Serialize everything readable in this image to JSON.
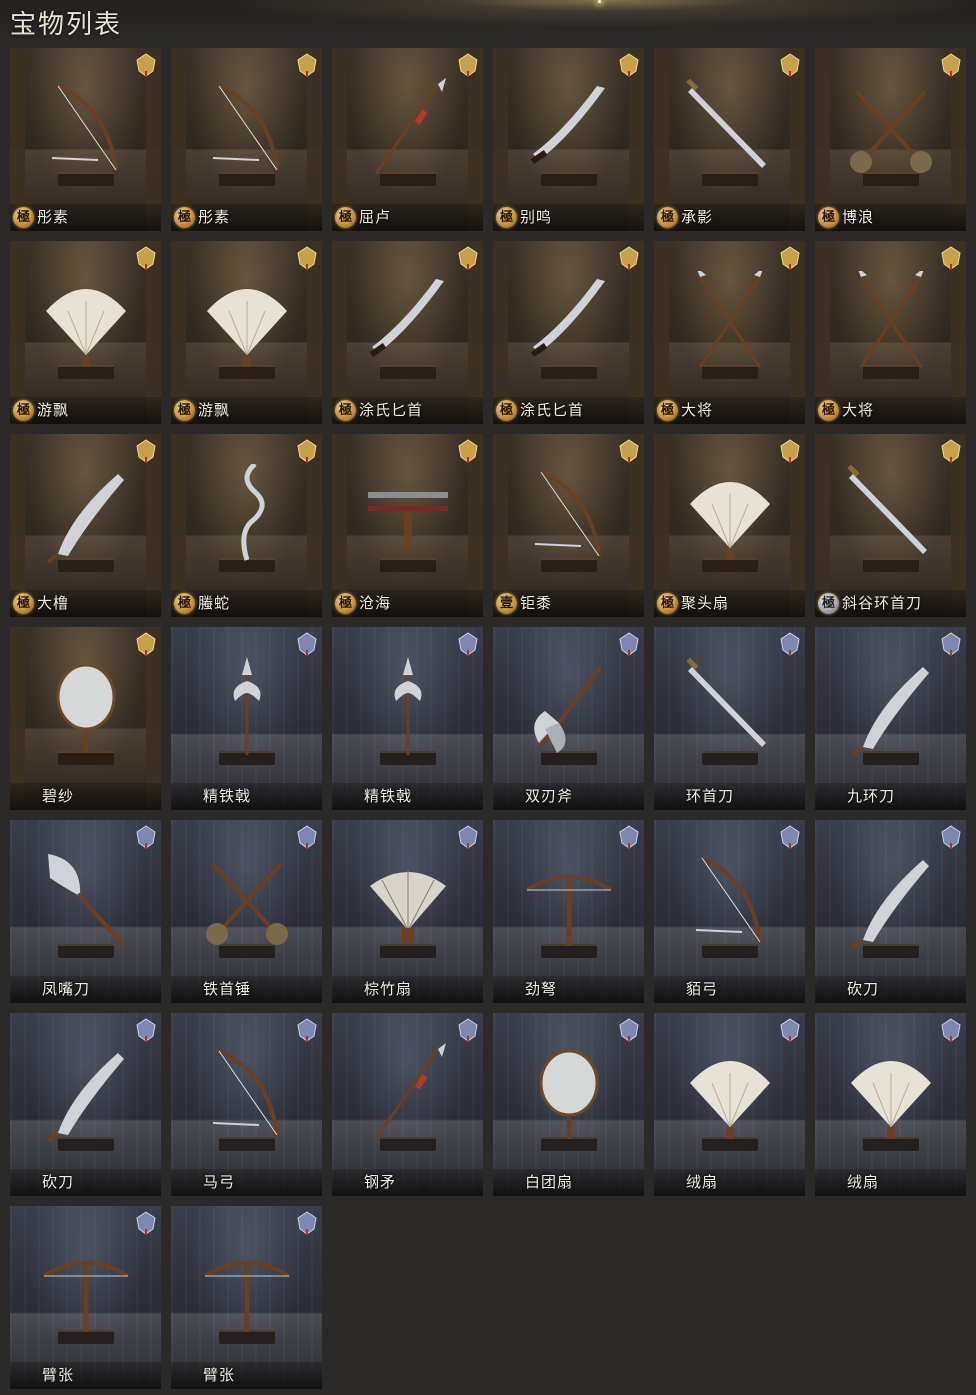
{
  "page": {
    "title": "宝物列表"
  },
  "colors": {
    "gold_rank": "#c8923e",
    "silver_rank": "#a8a8ae",
    "gold_bg": "#3a3127",
    "blue_bg": "#3a3e4a"
  },
  "cards": [
    {
      "name": "彤素",
      "rank": "極",
      "tier": "gold",
      "icon": "bow-icon"
    },
    {
      "name": "彤素",
      "rank": "極",
      "tier": "gold",
      "icon": "bow-icon"
    },
    {
      "name": "屈卢",
      "rank": "極",
      "tier": "gold",
      "icon": "spear-icon"
    },
    {
      "name": "别鸣",
      "rank": "極",
      "tier": "gold",
      "icon": "dagger-icon"
    },
    {
      "name": "承影",
      "rank": "極",
      "tier": "gold",
      "icon": "sword-icon"
    },
    {
      "name": "博浪",
      "rank": "極",
      "tier": "gold",
      "icon": "hammer-icon"
    },
    {
      "name": "游飘",
      "rank": "極",
      "tier": "gold",
      "icon": "feather-fan-icon"
    },
    {
      "name": "游飘",
      "rank": "極",
      "tier": "gold",
      "icon": "feather-fan-icon"
    },
    {
      "name": "涂氏匕首",
      "rank": "極",
      "tier": "gold",
      "icon": "dagger-icon"
    },
    {
      "name": "涂氏匕首",
      "rank": "極",
      "tier": "gold",
      "icon": "dagger-icon"
    },
    {
      "name": "大将",
      "rank": "極",
      "tier": "gold",
      "icon": "crossed-spears-icon"
    },
    {
      "name": "大将",
      "rank": "極",
      "tier": "gold",
      "icon": "crossed-spears-icon"
    },
    {
      "name": "大橹",
      "rank": "極",
      "tier": "gold",
      "icon": "blade-icon"
    },
    {
      "name": "螣蛇",
      "rank": "極",
      "tier": "gold",
      "icon": "serpent-spear-icon"
    },
    {
      "name": "沧海",
      "rank": "極",
      "tier": "gold",
      "icon": "sword-rack-icon"
    },
    {
      "name": "钜黍",
      "rank": "壹",
      "tier": "gold",
      "icon": "bow-icon"
    },
    {
      "name": "聚头扇",
      "rank": "極",
      "tier": "gold",
      "icon": "feather-fan-icon"
    },
    {
      "name": "斜谷环首刀",
      "rank": "極",
      "tier": "gold",
      "rank_style": "silver",
      "icon": "sword-icon"
    },
    {
      "name": "碧纱",
      "rank": "",
      "tier": "gold",
      "icon": "round-fan-icon"
    },
    {
      "name": "精铁戟",
      "rank": "",
      "tier": "blue",
      "icon": "halberd-icon"
    },
    {
      "name": "精铁戟",
      "rank": "",
      "tier": "blue",
      "icon": "halberd-icon"
    },
    {
      "name": "双刃斧",
      "rank": "",
      "tier": "blue",
      "icon": "axe-icon"
    },
    {
      "name": "环首刀",
      "rank": "",
      "tier": "blue",
      "icon": "sword-icon"
    },
    {
      "name": "九环刀",
      "rank": "",
      "tier": "blue",
      "icon": "blade-icon"
    },
    {
      "name": "凤嘴刀",
      "rank": "",
      "tier": "blue",
      "icon": "glaive-icon"
    },
    {
      "name": "铁首锤",
      "rank": "",
      "tier": "blue",
      "icon": "hammer-icon"
    },
    {
      "name": "棕竹扇",
      "rank": "",
      "tier": "blue",
      "icon": "folding-fan-icon"
    },
    {
      "name": "劲弩",
      "rank": "",
      "tier": "blue",
      "icon": "crossbow-icon"
    },
    {
      "name": "貊弓",
      "rank": "",
      "tier": "blue",
      "icon": "bow-icon"
    },
    {
      "name": "砍刀",
      "rank": "",
      "tier": "blue",
      "icon": "blade-icon"
    },
    {
      "name": "砍刀",
      "rank": "",
      "tier": "blue",
      "icon": "blade-icon"
    },
    {
      "name": "马弓",
      "rank": "",
      "tier": "blue",
      "icon": "bow-icon"
    },
    {
      "name": "钢矛",
      "rank": "",
      "tier": "blue",
      "icon": "spear-icon"
    },
    {
      "name": "白团扇",
      "rank": "",
      "tier": "blue",
      "icon": "round-fan-icon"
    },
    {
      "name": "绒扇",
      "rank": "",
      "tier": "blue",
      "icon": "feather-fan-icon"
    },
    {
      "name": "绒扇",
      "rank": "",
      "tier": "blue",
      "icon": "feather-fan-icon"
    },
    {
      "name": "臂张",
      "rank": "",
      "tier": "blue",
      "icon": "crossbow-icon"
    },
    {
      "name": "臂张",
      "rank": "",
      "tier": "blue",
      "icon": "crossbow-icon"
    }
  ]
}
